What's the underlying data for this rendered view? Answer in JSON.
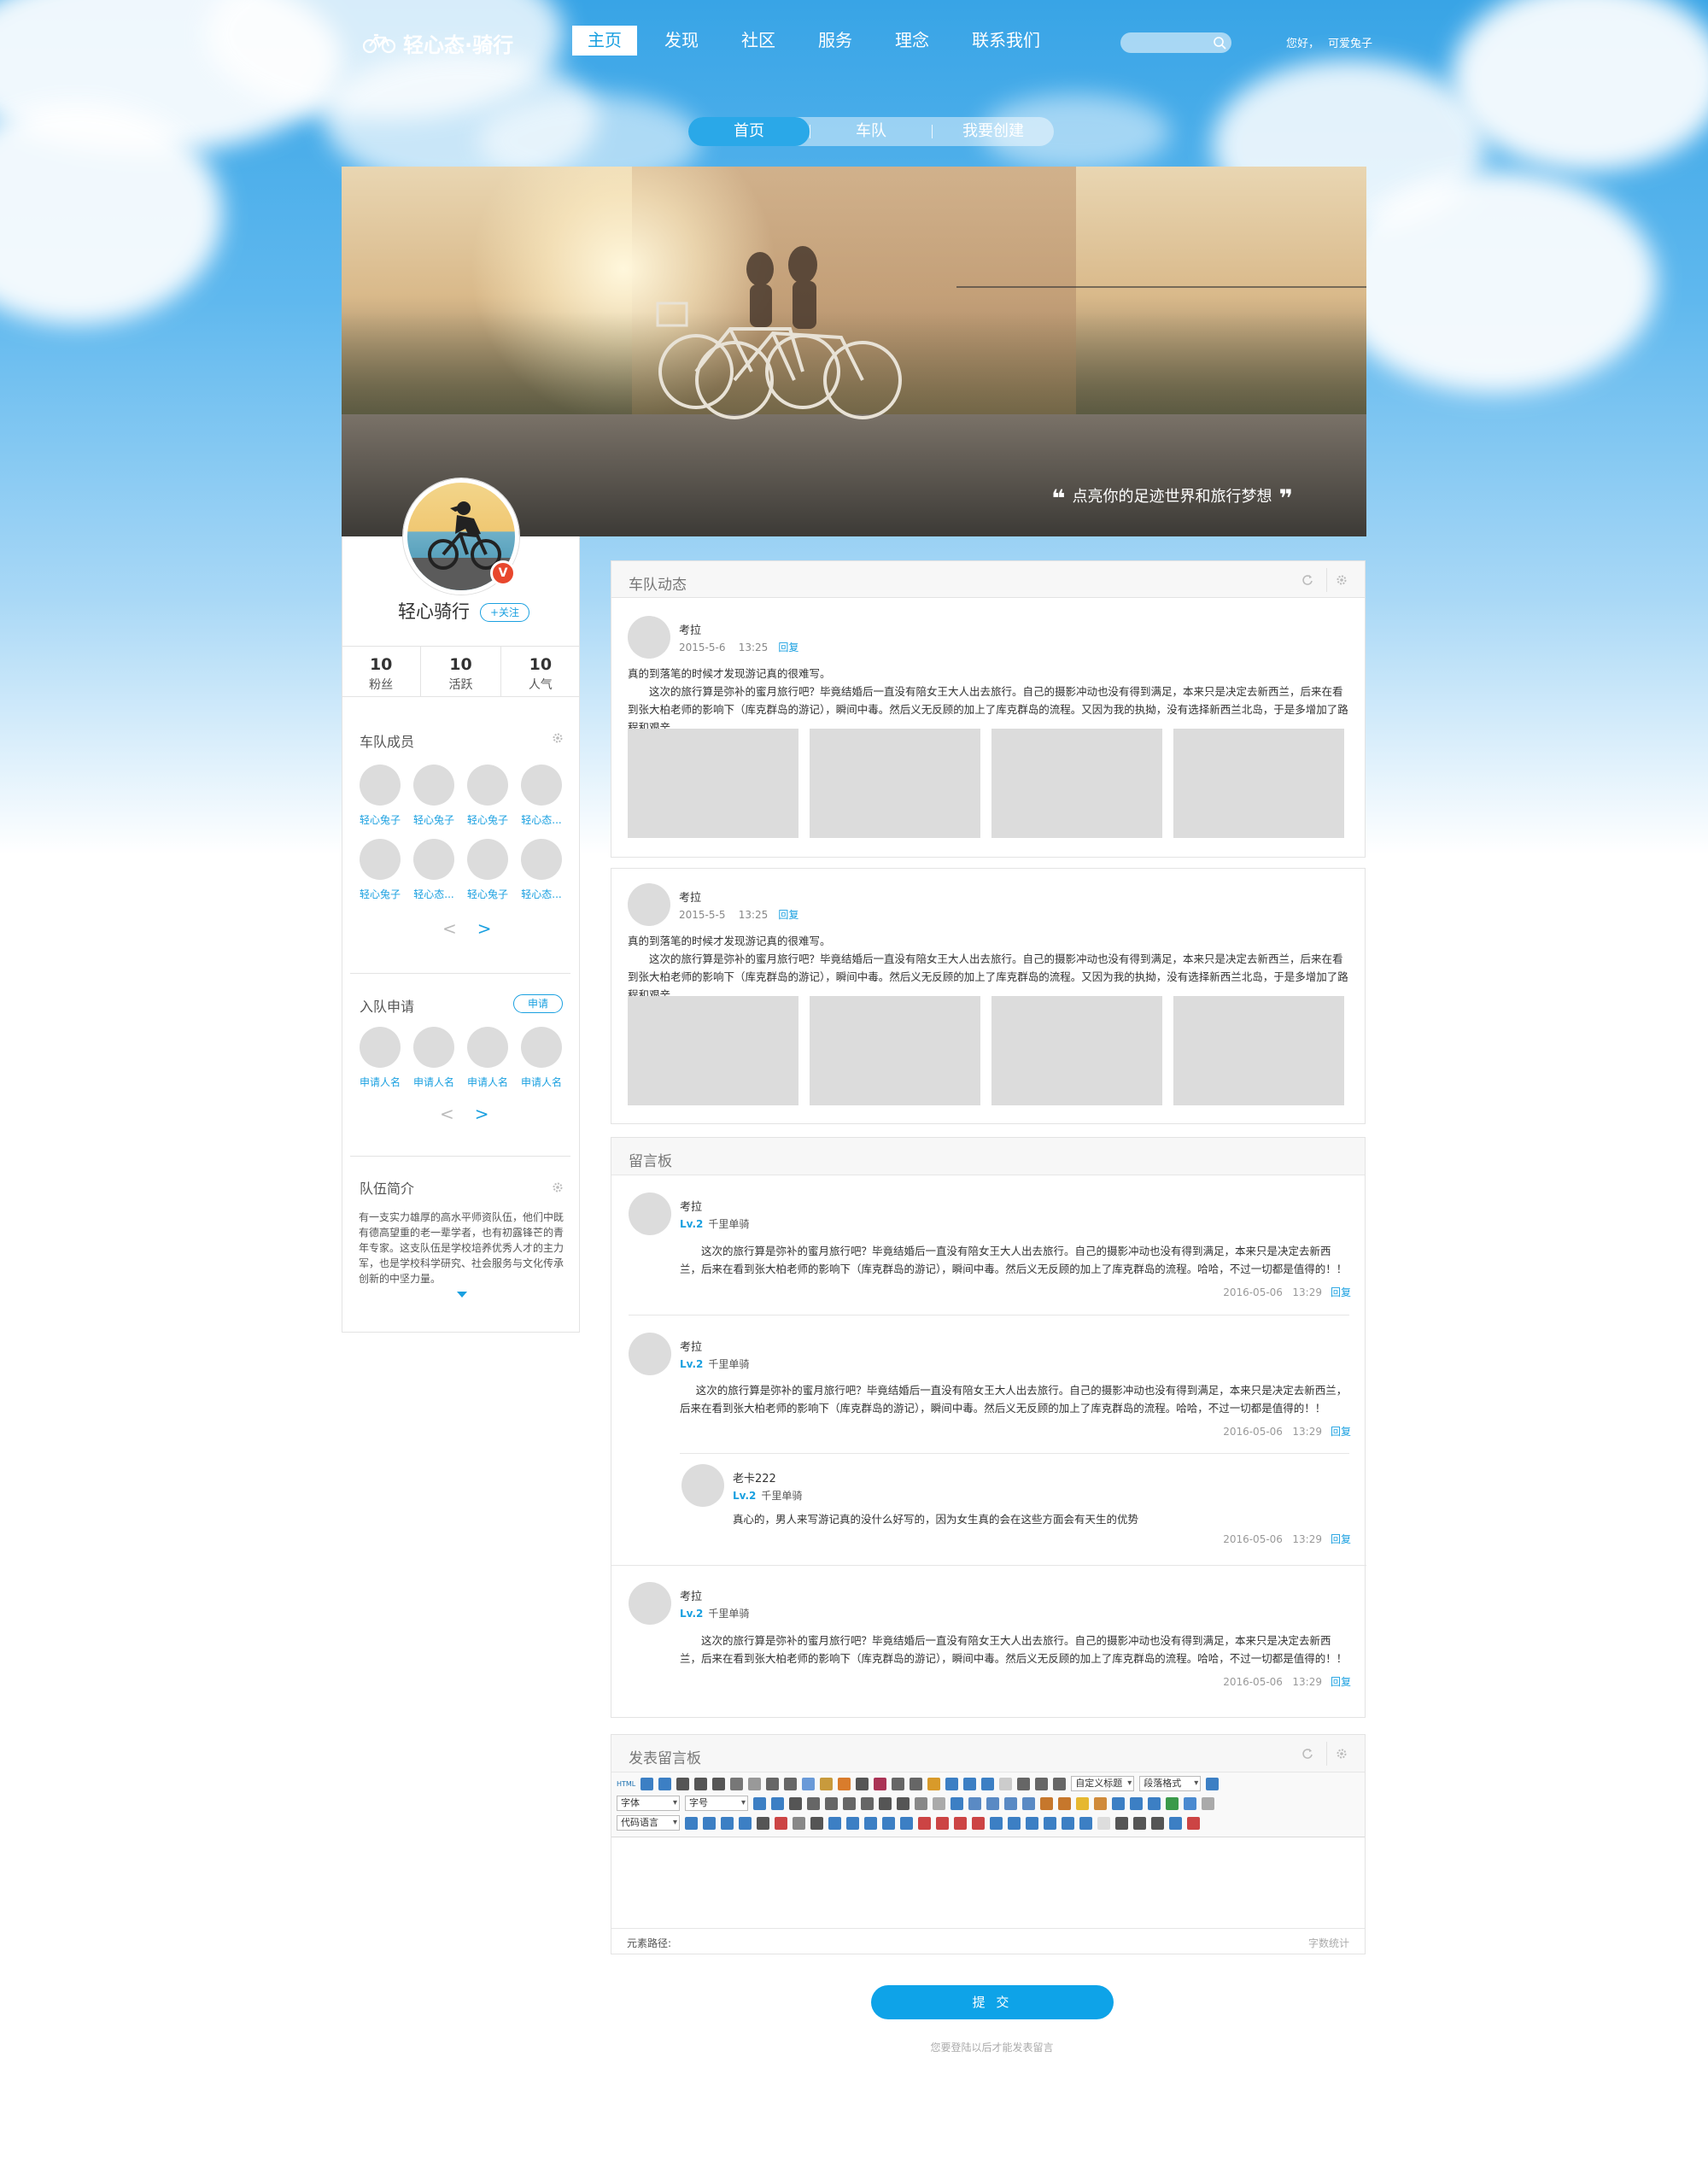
{
  "header": {
    "logo_text": "轻心态·骑行",
    "nav": [
      "主页",
      "发现",
      "社区",
      "服务",
      "理念",
      "联系我们"
    ],
    "nav_active": 0,
    "search_placeholder": "",
    "greeting": "您好，",
    "username": "可爱兔子"
  },
  "subnav": {
    "items": [
      "首页",
      "车队",
      "我要创建"
    ],
    "active": 0
  },
  "banner": {
    "quote": "点亮你的足迹世界和旅行梦想",
    "quote_open": "❝",
    "quote_close": "❞"
  },
  "profile": {
    "badge": "V",
    "name": "轻心骑行",
    "follow_label": "+关注",
    "stats": [
      {
        "num": "10",
        "label": "粉丝"
      },
      {
        "num": "10",
        "label": "活跃"
      },
      {
        "num": "10",
        "label": "人气"
      }
    ]
  },
  "members": {
    "title": "车队成员",
    "names": [
      "轻心兔子",
      "轻心兔子",
      "轻心兔子",
      "轻心态...",
      "轻心兔子",
      "轻心态...",
      "轻心兔子",
      "轻心态..."
    ],
    "prev": "<",
    "next": ">"
  },
  "applications": {
    "title": "入队申请",
    "apply_label": "申请",
    "names": [
      "申请人名",
      "申请人名",
      "申请人名",
      "申请人名"
    ],
    "prev": "<",
    "next": ">"
  },
  "intro": {
    "title": "队伍简介",
    "text": "有一支实力雄厚的高水平师资队伍，他们中既有德高望重的老一辈学者，也有初露锋芒的青年专家。这支队伍是学校培养优秀人才的主力军，也是学校科学研究、社会服务与文化传承创新的中坚力量。"
  },
  "feed": {
    "title": "车队动态",
    "posts": [
      {
        "author": "考拉",
        "date": "2015-5-6",
        "time": "13:25",
        "reply": "回复",
        "headline": "真的到落笔的时候才发现游记真的很难写。",
        "body": "这次的旅行算是弥补的蜜月旅行吧？毕竟结婚后一直没有陪女王大人出去旅行。自己的摄影冲动也没有得到满足，本来只是决定去新西兰，后来在看到张大柏老师的影响下（库克群岛的游记），瞬间中毒。然后义无反顾的加上了库克群岛的流程。又因为我的执拗，没有选择新西兰北岛，于是多增加了路程和艰辛，"
      },
      {
        "author": "考拉",
        "date": "2015-5-5",
        "time": "13:25",
        "reply": "回复",
        "headline": "真的到落笔的时候才发现游记真的很难写。",
        "body": "这次的旅行算是弥补的蜜月旅行吧？毕竟结婚后一直没有陪女王大人出去旅行。自己的摄影冲动也没有得到满足，本来只是决定去新西兰，后来在看到张大柏老师的影响下（库克群岛的游记），瞬间中毒。然后义无反顾的加上了库克群岛的流程。又因为我的执拗，没有选择新西兰北岛，于是多增加了路程和艰辛，"
      }
    ]
  },
  "guestbook": {
    "title": "留言板",
    "messages": [
      {
        "author": "考拉",
        "level": "Lv.2",
        "rank": "千里单骑",
        "text": "这次的旅行算是弥补的蜜月旅行吧？毕竟结婚后一直没有陪女王大人出去旅行。自己的摄影冲动也没有得到满足，本来只是决定去新西兰，后来在看到张大柏老师的影响下（库克群岛的游记），瞬间中毒。然后义无反顾的加上了库克群岛的流程。哈哈，不过一切都是值得的！！",
        "date": "2016-05-06",
        "time": "13:29",
        "reply": "回复"
      },
      {
        "author": "考拉",
        "level": "Lv.2",
        "rank": "千里单骑",
        "text": "这次的旅行算是弥补的蜜月旅行吧？毕竟结婚后一直没有陪女王大人出去旅行。自己的摄影冲动也没有得到满足，本来只是决定去新西兰，后来在看到张大柏老师的影响下（库克群岛的游记），瞬间中毒。然后义无反顾的加上了库克群岛的流程。哈哈，不过一切都是值得的！！",
        "date": "2016-05-06",
        "time": "13:29",
        "reply": "回复",
        "sub": {
          "author": "老卡222",
          "level": "Lv.2",
          "rank": "千里单骑",
          "text": "真心的，男人来写游记真的没什么好写的，因为女生真的会在这些方面会有天生的优势",
          "date": "2016-05-06",
          "time": "13:29",
          "reply": "回复"
        }
      },
      {
        "author": "考拉",
        "level": "Lv.2",
        "rank": "千里单骑",
        "text": "这次的旅行算是弥补的蜜月旅行吧？毕竟结婚后一直没有陪女王大人出去旅行。自己的摄影冲动也没有得到满足，本来只是决定去新西兰，后来在看到张大柏老师的影响下（库克群岛的游记），瞬间中毒。然后义无反顾的加上了库克群岛的流程。哈哈，不过一切都是值得的！！",
        "date": "2016-05-06",
        "time": "13:29",
        "reply": "回复"
      }
    ]
  },
  "editor": {
    "title": "发表留言板",
    "html_label": "HTML",
    "font_label": "字体",
    "size_label": "字号",
    "code_label": "代码语言",
    "custom_title": "自定义标题",
    "para_format": "段落格式",
    "path_label": "元素路径:",
    "word_count": "字数统计"
  },
  "submit_label": "提 交",
  "login_tip": "您要登陆以后才能发表留言"
}
